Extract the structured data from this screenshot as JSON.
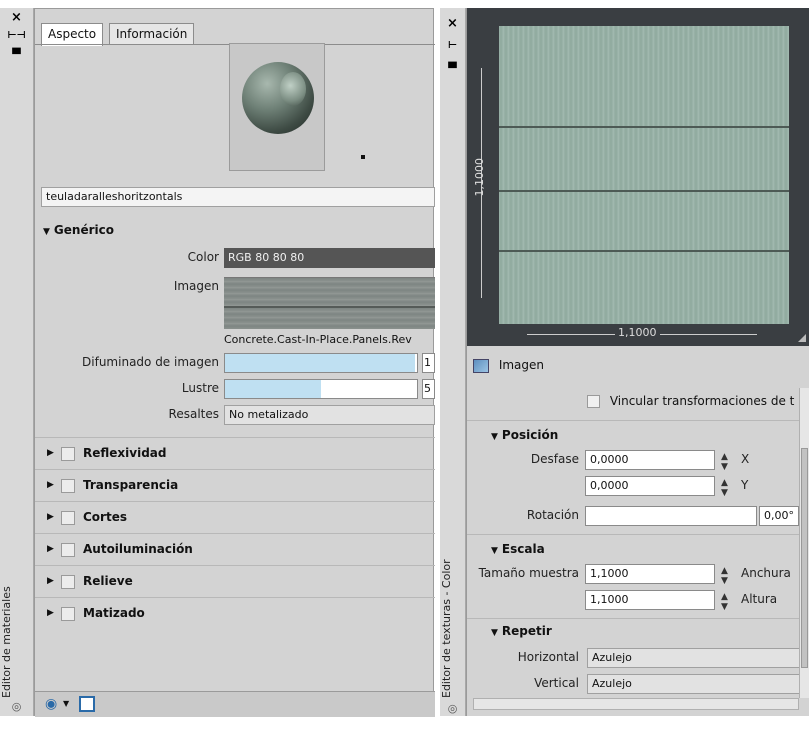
{
  "materials_palette": {
    "vertical_label": "Editor de materiales",
    "close_glyph": "×"
  },
  "material_editor": {
    "tabs": [
      {
        "label": "Aspecto",
        "active": true
      },
      {
        "label": "Información",
        "active": false
      }
    ],
    "material_name": "teuladaralleshoritzontals",
    "generic": {
      "title": "Genérico",
      "color_label": "Color",
      "color_value": "RGB 80 80 80",
      "image_label": "Imagen",
      "image_caption": "Concrete.Cast-In-Place.Panels.Rev",
      "fade_label": "Difuminado de imagen",
      "fade_value": "1",
      "fade_fraction": 0.99,
      "gloss_label": "Lustre",
      "gloss_value": "5",
      "gloss_fraction": 0.5,
      "highlights_label": "Resaltes",
      "highlights_value": "No metalizado"
    },
    "groups": [
      {
        "label": "Reflexividad"
      },
      {
        "label": "Transparencia"
      },
      {
        "label": "Cortes"
      },
      {
        "label": "Autoiluminación"
      },
      {
        "label": "Relieve"
      },
      {
        "label": "Matizado"
      }
    ]
  },
  "texture_palette": {
    "vertical_label": "Editor de texturas - Color",
    "close_glyph": "×"
  },
  "texture_editor": {
    "dim_vertical": "1,1000",
    "dim_horizontal": "1,1000",
    "image_label": "Imagen",
    "link_transforms_label": "Vincular transformaciones de t",
    "position": {
      "title": "Posición",
      "offset_label": "Desfase",
      "offset_x": "0,0000",
      "offset_y": "0,0000",
      "x_axis": "X",
      "y_axis": "Y",
      "rotation_label": "Rotación",
      "rotation_value": "0,00°"
    },
    "scale": {
      "title": "Escala",
      "sample_size_label": "Tamaño muestra",
      "width_value": "1,1000",
      "height_value": "1,1000",
      "width_label": "Anchura",
      "height_label": "Altura"
    },
    "repeat": {
      "title": "Repetir",
      "horizontal_label": "Horizontal",
      "horizontal_value": "Azulejo",
      "vertical_label": "Vertical",
      "vertical_value": "Azulejo"
    }
  },
  "colors": {
    "panel_bg": "#d3d3d3",
    "slider_fill": "#bfe0f2",
    "texture_preview_bg": "#3a3e42"
  }
}
